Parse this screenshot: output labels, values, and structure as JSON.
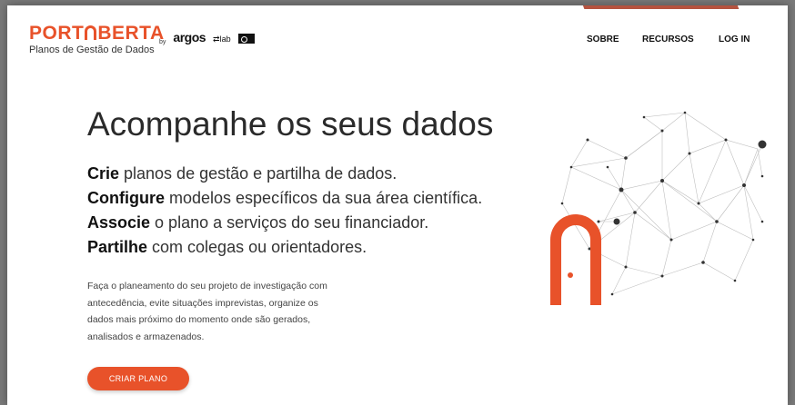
{
  "brand": {
    "logo_pre": "PORT",
    "logo_post": "BERTA",
    "subtitle": "Planos de Gestão de Dados"
  },
  "partners": {
    "by": "by",
    "argos": "argos",
    "lab": "lab"
  },
  "nav": {
    "about": "SOBRE",
    "resources": "RECURSOS",
    "login": "LOG IN"
  },
  "hero": {
    "headline": "Acompanhe os seus dados",
    "features": [
      {
        "bold": "Crie",
        "rest": " planos de gestão e partilha de dados."
      },
      {
        "bold": "Configure",
        "rest": " modelos específicos da sua área científica."
      },
      {
        "bold": "Associe",
        "rest": " o plano a serviços do seu financiador."
      },
      {
        "bold": "Partilhe",
        "rest": " com colegas ou orientadores."
      }
    ],
    "paragraph": "Faça o planeamento do seu projeto de investigação com antecedência, evite situações imprevistas, organize os dados mais próximo do momento onde são gerados, analisados e armazenados.",
    "cta": "CRIAR PLANO"
  },
  "colors": {
    "accent": "#e8522a",
    "text": "#2a2a2a"
  },
  "icons": {
    "hero_illustration": "network-graph-with-arch-icon"
  }
}
